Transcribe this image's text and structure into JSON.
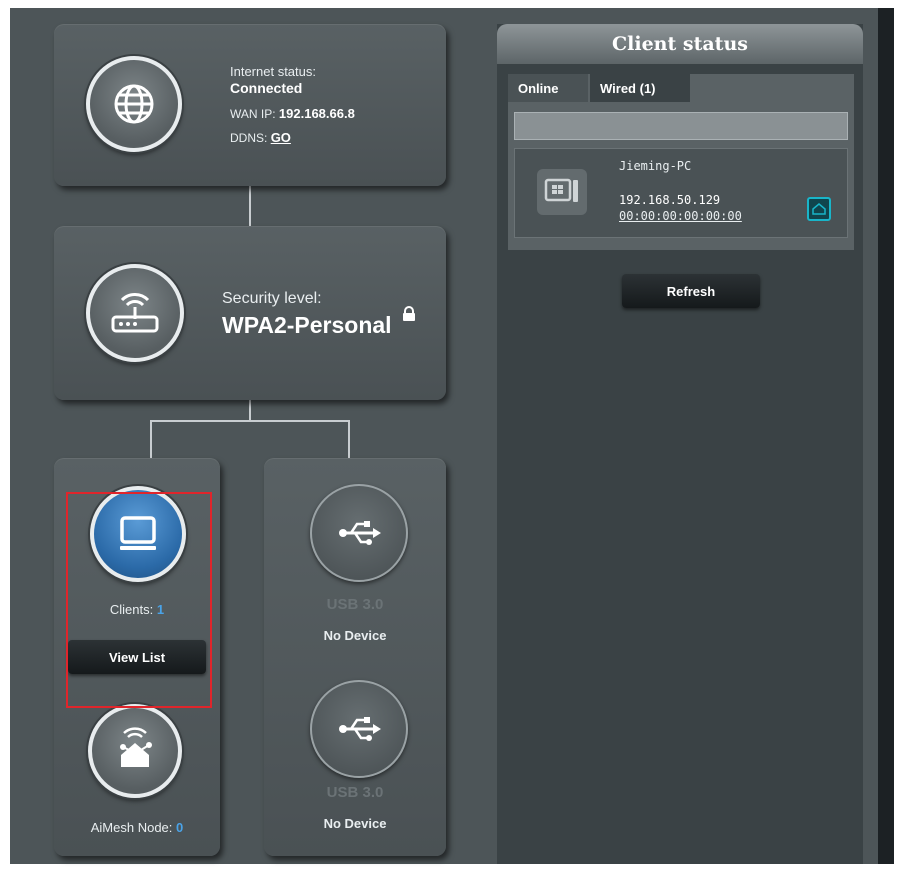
{
  "internet": {
    "status_label": "Internet status:",
    "status_value": "Connected",
    "wan_label": "WAN IP:",
    "wan_ip": "192.168.66.8",
    "ddns_label": "DDNS:",
    "ddns_link": "GO",
    "icon": "globe-icon"
  },
  "security": {
    "label": "Security level:",
    "value": "WPA2-Personal",
    "icon": "router-icon",
    "lock_icon": "lock-icon"
  },
  "clients": {
    "label": "Clients:",
    "count": "1",
    "view_list": "View List",
    "icon": "monitor-icon"
  },
  "aimesh": {
    "label": "AiMesh Node:",
    "count": "0",
    "icon": "mesh-house-icon"
  },
  "usb": [
    {
      "label": "USB 3.0",
      "status": "No Device",
      "icon": "usb-icon"
    },
    {
      "label": "USB 3.0",
      "status": "No Device",
      "icon": "usb-icon"
    }
  ],
  "client_status": {
    "title": "Client status",
    "tabs": [
      "Online",
      "Wired (1)"
    ],
    "clients": [
      {
        "name": "Jieming-PC",
        "ip": "192.168.50.129",
        "mac": "00:00:00:00:00:00",
        "icon": "windows-pc-icon",
        "badge_icon": "house-badge-icon"
      }
    ],
    "refresh": "Refresh"
  },
  "colors": {
    "panel_bg": "#4d5558",
    "accent_blue": "#2b6aa8",
    "link_blue": "#4aa3e8",
    "highlight_red": "#e0252b",
    "badge_teal": "#19b5c9"
  }
}
